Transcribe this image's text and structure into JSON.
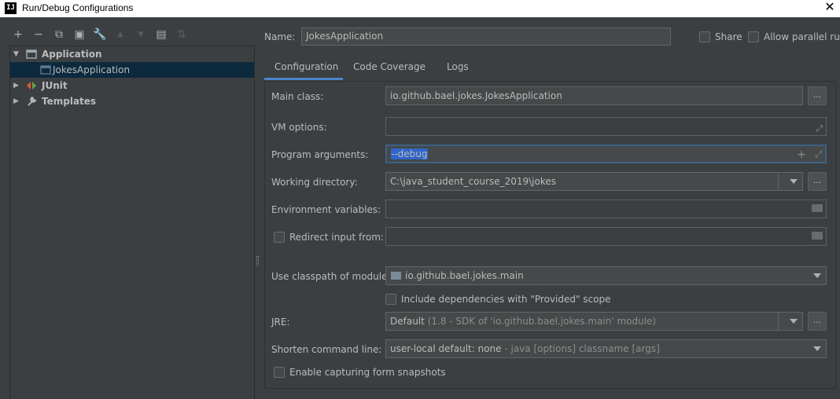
{
  "window": {
    "title": "Run/Debug Configurations",
    "app_icon": "IJ",
    "close_glyph": "✕"
  },
  "toolbar": {
    "items": [
      {
        "icon": "add-icon",
        "glyph": "+",
        "enabled": true
      },
      {
        "icon": "remove-icon",
        "glyph": "−",
        "enabled": true
      },
      {
        "icon": "copy-icon",
        "glyph": "⧉",
        "enabled": true
      },
      {
        "icon": "save-icon",
        "glyph": "▣",
        "enabled": true
      },
      {
        "icon": "wrench-icon",
        "glyph": "🔧",
        "enabled": true
      },
      {
        "icon": "move-up-icon",
        "glyph": "▲",
        "enabled": false
      },
      {
        "icon": "move-down-icon",
        "glyph": "▼",
        "enabled": false
      },
      {
        "icon": "new-folder-icon",
        "glyph": "▤",
        "enabled": true
      },
      {
        "icon": "sort-icon",
        "glyph": "⇅",
        "enabled": false
      }
    ]
  },
  "tree": {
    "application": "Application",
    "jokes_application": "JokesApplication",
    "junit": "JUnit",
    "templates": "Templates"
  },
  "header": {
    "name_label": "Name:",
    "name_value": "JokesApplication",
    "share_label": "Share",
    "parallel_label": "Allow parallel run"
  },
  "tabs": {
    "configuration": "Configuration",
    "code_coverage": "Code Coverage",
    "logs": "Logs"
  },
  "form": {
    "main_class_label": "Main class:",
    "main_class_value": "io.github.bael.jokes.JokesApplication",
    "vm_options_label": "VM options:",
    "vm_options_value": "",
    "program_args_label": "Program arguments:",
    "program_args_value": "--debug",
    "working_dir_label": "Working directory:",
    "working_dir_value": "C:\\java_student_course_2019\\jokes",
    "env_vars_label": "Environment variables:",
    "env_vars_value": "",
    "redirect_label": "Redirect input from:",
    "redirect_value": "",
    "classpath_label": "Use classpath of module:",
    "classpath_value": "io.github.bael.jokes.main",
    "include_deps_label": "Include dependencies with \"Provided\" scope",
    "jre_label": "JRE:",
    "jre_value": "Default",
    "jre_detail": "(1.8 - SDK of 'io.github.bael.jokes.main' module)",
    "shorten_label": "Shorten command line:",
    "shorten_value": "user-local default: none",
    "shorten_detail": "- java [options] classname [args]",
    "capture_label": "Enable capturing form snapshots",
    "dots": "..."
  }
}
